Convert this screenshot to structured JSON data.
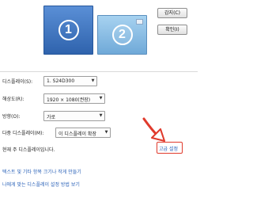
{
  "preview": {
    "monitor_1_number": "1",
    "monitor_2_number": "2",
    "detect_button": "감지(C)",
    "identify_button": "확인(I)"
  },
  "settings": {
    "display": {
      "label": "디스플레이(S):",
      "value": "1. S24D300"
    },
    "resolution": {
      "label": "해상도(R):",
      "value": "1920 × 1080(권장)"
    },
    "orientation": {
      "label": "방향(O):",
      "value": "가로"
    },
    "multi_display": {
      "label": "다중 디스플레이(M):",
      "value": "이 디스플레이 확장"
    }
  },
  "status": {
    "text": "현재 주 디스플레이입니다.",
    "advanced_link": "고급 설정"
  },
  "help_links": [
    "텍스트 및 기타 항목 크기나 작게 만들기",
    "나에게 맞는 디스플레이 설정 방법 보기"
  ],
  "colors": {
    "highlight": "#e03a2c",
    "link": "#1a58b6",
    "monitor_selected": "#2f63ad"
  },
  "icons": {
    "arrow": "callout-arrow-icon"
  }
}
